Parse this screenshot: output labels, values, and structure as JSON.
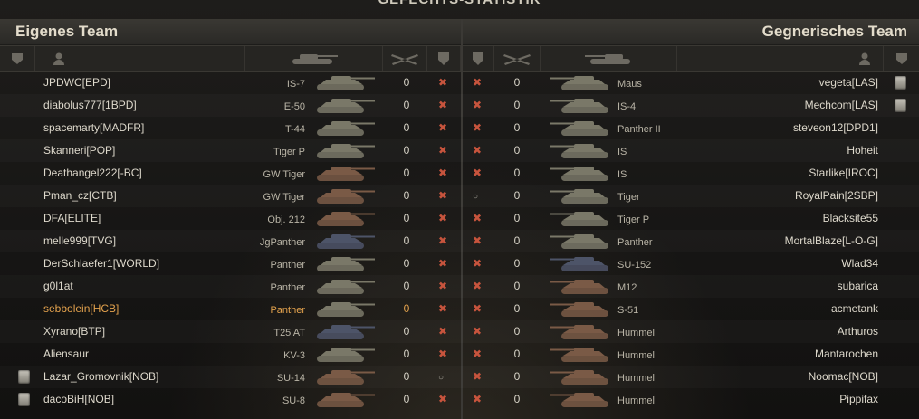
{
  "title": "GEFECHTS-STATISTIK",
  "left_team": "Eigenes Team",
  "right_team": "Gegnerisches Team",
  "colors": {
    "tank_dark": "#7a7868",
    "tank_brown": "#7a5a46",
    "tank_blue": "#4d5468",
    "self_highlight": "#e3a24d",
    "destroyed_mark": "#c7543d"
  },
  "icons": {
    "rank": "shield-icon",
    "player": "person-icon",
    "vehicle": "tank-icon",
    "frags": "crossed-tanks-icon",
    "destroyed": "x-mark",
    "alive": "circle-mark"
  },
  "rows": [
    {
      "l_badge": false,
      "l_name": "JPDWC[EPD]",
      "l_vehicle": "IS-7",
      "l_tank": "dark",
      "l_frags": "0",
      "l_status": "x",
      "r_status": "x",
      "r_frags": "0",
      "r_tank": "dark",
      "r_vehicle": "Maus",
      "r_name": "vegeta[LAS]",
      "r_badge": true,
      "self": false
    },
    {
      "l_badge": false,
      "l_name": "diabolus777[1BPD]",
      "l_vehicle": "E-50",
      "l_tank": "dark",
      "l_frags": "0",
      "l_status": "x",
      "r_status": "x",
      "r_frags": "0",
      "r_tank": "dark",
      "r_vehicle": "IS-4",
      "r_name": "Mechcom[LAS]",
      "r_badge": true,
      "self": false
    },
    {
      "l_badge": false,
      "l_name": "spacemarty[MADFR]",
      "l_vehicle": "T-44",
      "l_tank": "dark",
      "l_frags": "0",
      "l_status": "x",
      "r_status": "x",
      "r_frags": "0",
      "r_tank": "dark",
      "r_vehicle": "Panther II",
      "r_name": "steveon12[DPD1]",
      "r_badge": false,
      "self": false
    },
    {
      "l_badge": false,
      "l_name": "Skanneri[POP]",
      "l_vehicle": "Tiger P",
      "l_tank": "dark",
      "l_frags": "0",
      "l_status": "x",
      "r_status": "x",
      "r_frags": "0",
      "r_tank": "dark",
      "r_vehicle": "IS",
      "r_name": "Hoheit",
      "r_badge": false,
      "self": false
    },
    {
      "l_badge": false,
      "l_name": "Deathangel222[-BC]",
      "l_vehicle": "GW Tiger",
      "l_tank": "brown",
      "l_frags": "0",
      "l_status": "x",
      "r_status": "x",
      "r_frags": "0",
      "r_tank": "dark",
      "r_vehicle": "IS",
      "r_name": "Starlike[IROC]",
      "r_badge": false,
      "self": false
    },
    {
      "l_badge": false,
      "l_name": "Pman_cz[CTB]",
      "l_vehicle": "GW Tiger",
      "l_tank": "brown",
      "l_frags": "0",
      "l_status": "x",
      "r_status": "o",
      "r_frags": "0",
      "r_tank": "dark",
      "r_vehicle": "Tiger",
      "r_name": "RoyalPain[2SBP]",
      "r_badge": false,
      "self": false
    },
    {
      "l_badge": false,
      "l_name": "DFA[ELITE]",
      "l_vehicle": "Obj. 212",
      "l_tank": "brown",
      "l_frags": "0",
      "l_status": "x",
      "r_status": "x",
      "r_frags": "0",
      "r_tank": "dark",
      "r_vehicle": "Tiger P",
      "r_name": "Blacksite55",
      "r_badge": false,
      "self": false
    },
    {
      "l_badge": false,
      "l_name": "melle999[TVG]",
      "l_vehicle": "JgPanther",
      "l_tank": "blue",
      "l_frags": "0",
      "l_status": "x",
      "r_status": "x",
      "r_frags": "0",
      "r_tank": "dark",
      "r_vehicle": "Panther",
      "r_name": "MortalBlaze[L-O-G]",
      "r_badge": false,
      "self": false
    },
    {
      "l_badge": false,
      "l_name": "DerSchlaefer1[WORLD]",
      "l_vehicle": "Panther",
      "l_tank": "dark",
      "l_frags": "0",
      "l_status": "x",
      "r_status": "x",
      "r_frags": "0",
      "r_tank": "blue",
      "r_vehicle": "SU-152",
      "r_name": "Wlad34",
      "r_badge": false,
      "self": false
    },
    {
      "l_badge": false,
      "l_name": "g0l1at",
      "l_vehicle": "Panther",
      "l_tank": "dark",
      "l_frags": "0",
      "l_status": "x",
      "r_status": "x",
      "r_frags": "0",
      "r_tank": "brown",
      "r_vehicle": "M12",
      "r_name": "subarica",
      "r_badge": false,
      "self": false
    },
    {
      "l_badge": false,
      "l_name": "sebbolein[HCB]",
      "l_vehicle": "Panther",
      "l_tank": "dark",
      "l_frags": "0",
      "l_status": "x",
      "r_status": "x",
      "r_frags": "0",
      "r_tank": "brown",
      "r_vehicle": "S-51",
      "r_name": "acmetank",
      "r_badge": false,
      "self": true
    },
    {
      "l_badge": false,
      "l_name": "Xyrano[BTP]",
      "l_vehicle": "T25 AT",
      "l_tank": "blue",
      "l_frags": "0",
      "l_status": "x",
      "r_status": "x",
      "r_frags": "0",
      "r_tank": "brown",
      "r_vehicle": "Hummel",
      "r_name": "Arthuros",
      "r_badge": false,
      "self": false
    },
    {
      "l_badge": false,
      "l_name": "Aliensaur",
      "l_vehicle": "KV-3",
      "l_tank": "dark",
      "l_frags": "0",
      "l_status": "x",
      "r_status": "x",
      "r_frags": "0",
      "r_tank": "brown",
      "r_vehicle": "Hummel",
      "r_name": "Mantarochen",
      "r_badge": false,
      "self": false
    },
    {
      "l_badge": true,
      "l_name": "Lazar_Gromovnik[NOB]",
      "l_vehicle": "SU-14",
      "l_tank": "brown",
      "l_frags": "0",
      "l_status": "o",
      "r_status": "x",
      "r_frags": "0",
      "r_tank": "brown",
      "r_vehicle": "Hummel",
      "r_name": "Noomac[NOB]",
      "r_badge": false,
      "self": false
    },
    {
      "l_badge": true,
      "l_name": "dacoBiH[NOB]",
      "l_vehicle": "SU-8",
      "l_tank": "brown",
      "l_frags": "0",
      "l_status": "x",
      "r_status": "x",
      "r_frags": "0",
      "r_tank": "brown",
      "r_vehicle": "Hummel",
      "r_name": "Pippifax",
      "r_badge": false,
      "self": false
    }
  ]
}
